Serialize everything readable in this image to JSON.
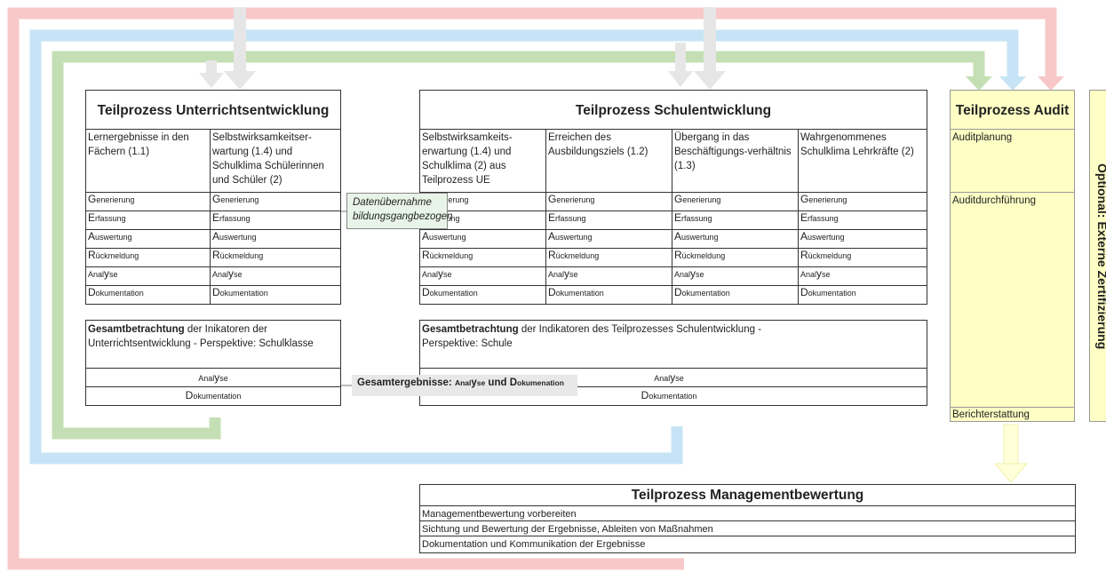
{
  "unterricht": {
    "title": "Teilprozess Unterrichtsentwicklung",
    "col1": "Lernergebnisse in den Fächern (1.1)",
    "col2": "Selbstwirksamkeitser-wartung (1.4) und Schulklima Schülerinnen und Schüler (2)",
    "steps": [
      "Generierung",
      "Erfassung",
      "Auswertung",
      "Rückmeldung",
      "Analyse",
      "Dokumentation"
    ],
    "gesamt_bold": "Gesamtbetrachtung",
    "gesamt_rest": " der Inikatoren der Unterrichtsentwicklung - Perspektive: Schulklasse",
    "analyse": "Analyse",
    "doku": "Dokumentation"
  },
  "schule": {
    "title": "Teilprozess Schulentwicklung",
    "cols": [
      "Selbstwirksamkeits-erwartung (1.4) und Schulklima (2) aus Teilprozess UE",
      "Erreichen des Ausbildungsziels (1.2)",
      "Übergang in das Beschäftigungs-verhältnis (1.3)",
      "Wahrgenommenes Schulklima Lehrkräfte (2)"
    ],
    "steps": [
      "Generierung",
      "Erfassung",
      "Auswertung",
      "Rückmeldung",
      "Analyse",
      "Dokumentation"
    ],
    "gesamt_bold": "Gesamtbetrachtung",
    "gesamt_rest": " der Indikatoren des Teilprozesses Schulentwicklung - Perspektive: Schule",
    "analyse": "Analyse",
    "doku": "Dokumentation"
  },
  "datenuebernahme": "Datenübernahme bildungsgangbezogen",
  "gesamtergebnisse": {
    "prefix": "Gesamtergebnisse: ",
    "analyse": "Analyse",
    "und": " und ",
    "doku": "Dokumenation"
  },
  "audit": {
    "title": "Teilprozess Audit",
    "items": [
      "Auditplanung",
      "Auditdurchführung",
      "Berichterstattung"
    ]
  },
  "extern": "Optional: Externe Zertifizierung",
  "management": {
    "title": "Teilprozess Managementbewertung",
    "items": [
      "Managementbewertung vorbereiten",
      "Sichtung und Bewertung der Ergebnisse, Ableiten von Maßnahmen",
      "Dokumentation und Kommunikation der Ergebnisse"
    ]
  },
  "colors": {
    "red_flow": "#f8c8c8",
    "blue_flow": "#c6e4f6",
    "green_flow": "#c5dfb4",
    "grey_arrow": "#e6e6e6",
    "audit_fill": "#ffffc5"
  }
}
